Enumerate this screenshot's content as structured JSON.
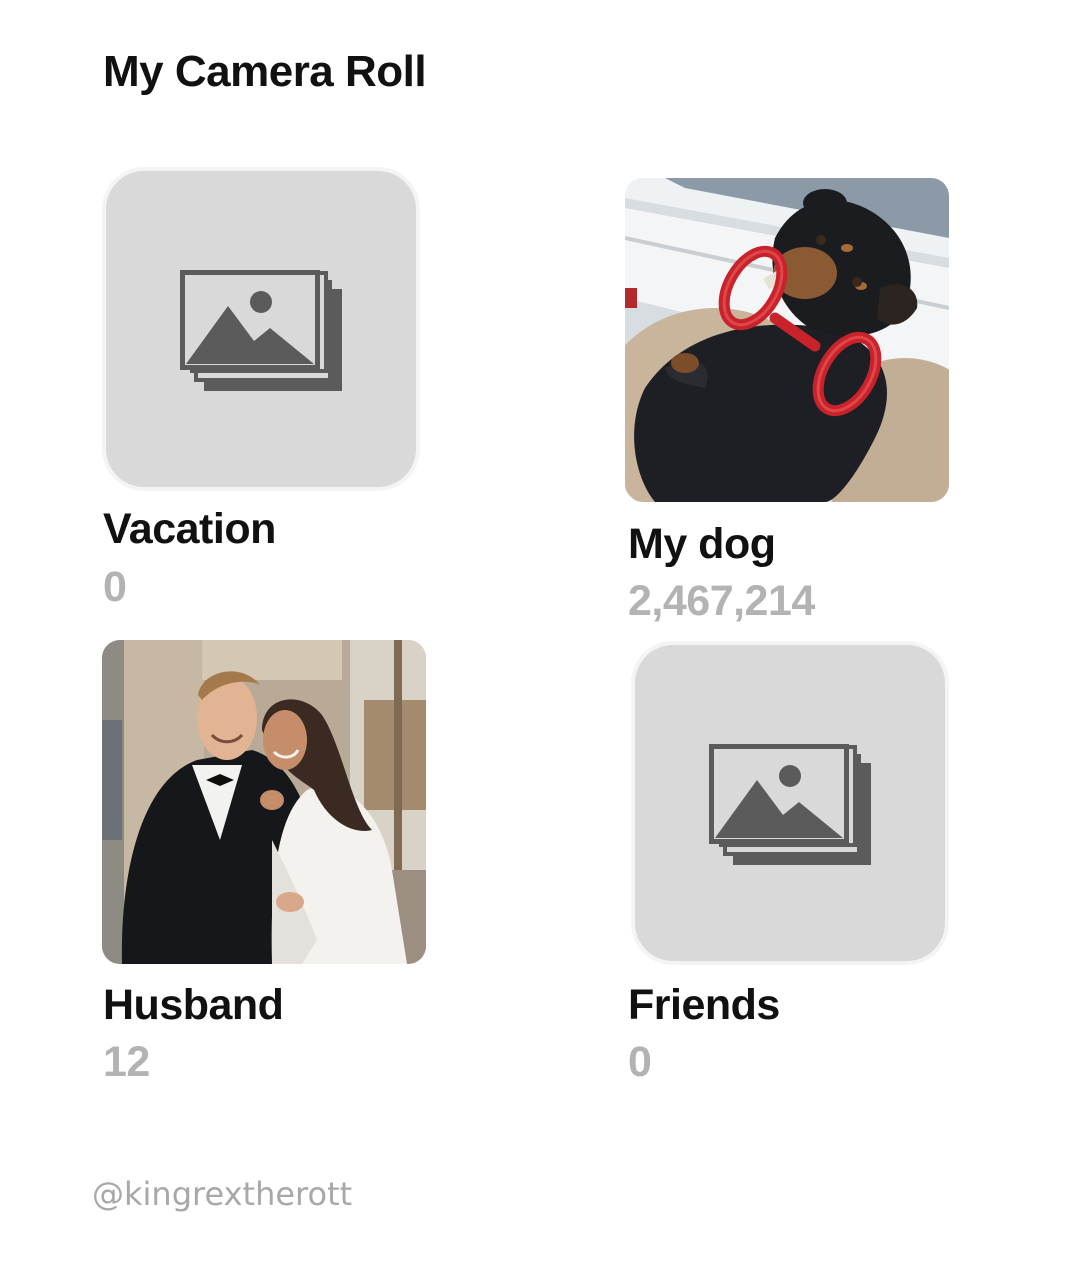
{
  "header": {
    "title": "My Camera Roll"
  },
  "albums": [
    {
      "name": "Vacation",
      "count": "0",
      "thumbnail": "photo-stack-placeholder-icon"
    },
    {
      "name": "My dog",
      "count": "2,467,214",
      "thumbnail": "dog-photo"
    },
    {
      "name": "Husband",
      "count": "12",
      "thumbnail": "couple-photo"
    },
    {
      "name": "Friends",
      "count": "0",
      "thumbnail": "photo-stack-placeholder-icon"
    }
  ],
  "footer": {
    "watermark": "@kingrextherott"
  },
  "colors": {
    "placeholder_background": "#d9d9d9",
    "placeholder_icon": "#5b5b5b",
    "count_text": "#b3b3b3",
    "title_text": "#111111"
  }
}
